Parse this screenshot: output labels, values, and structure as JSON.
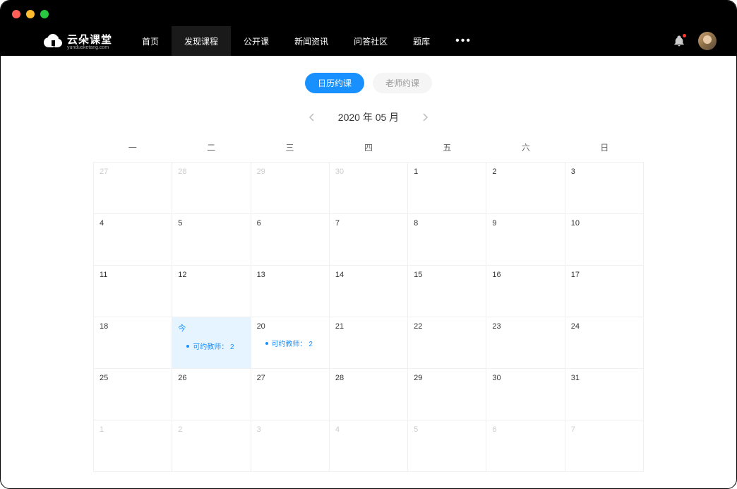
{
  "logo": {
    "main": "云朵课堂",
    "sub": "yunduoketang.com"
  },
  "nav": {
    "items": [
      "首页",
      "发现课程",
      "公开课",
      "新闻资讯",
      "问答社区",
      "题库"
    ],
    "activeIndex": 1
  },
  "tabs": {
    "calendar": "日历约课",
    "teacher": "老师约课"
  },
  "month": {
    "label": "2020 年 05 月"
  },
  "weekdays": [
    "一",
    "二",
    "三",
    "四",
    "五",
    "六",
    "日"
  ],
  "todayLabel": "今",
  "event": {
    "prefix": "可约教师：",
    "count": "2"
  },
  "cells": [
    {
      "d": "27",
      "muted": true
    },
    {
      "d": "28",
      "muted": true
    },
    {
      "d": "29",
      "muted": true
    },
    {
      "d": "30",
      "muted": true
    },
    {
      "d": "1"
    },
    {
      "d": "2"
    },
    {
      "d": "3"
    },
    {
      "d": "4"
    },
    {
      "d": "5"
    },
    {
      "d": "6"
    },
    {
      "d": "7"
    },
    {
      "d": "8"
    },
    {
      "d": "9"
    },
    {
      "d": "10"
    },
    {
      "d": "11"
    },
    {
      "d": "12"
    },
    {
      "d": "13"
    },
    {
      "d": "14"
    },
    {
      "d": "15"
    },
    {
      "d": "16"
    },
    {
      "d": "17"
    },
    {
      "d": "18"
    },
    {
      "d": "今",
      "today": true,
      "event": true
    },
    {
      "d": "20",
      "event": true
    },
    {
      "d": "21"
    },
    {
      "d": "22"
    },
    {
      "d": "23"
    },
    {
      "d": "24"
    },
    {
      "d": "25"
    },
    {
      "d": "26"
    },
    {
      "d": "27"
    },
    {
      "d": "28"
    },
    {
      "d": "29"
    },
    {
      "d": "30"
    },
    {
      "d": "31"
    },
    {
      "d": "1",
      "muted": true
    },
    {
      "d": "2",
      "muted": true
    },
    {
      "d": "3",
      "muted": true
    },
    {
      "d": "4",
      "muted": true
    },
    {
      "d": "5",
      "muted": true
    },
    {
      "d": "6",
      "muted": true
    },
    {
      "d": "7",
      "muted": true
    }
  ]
}
